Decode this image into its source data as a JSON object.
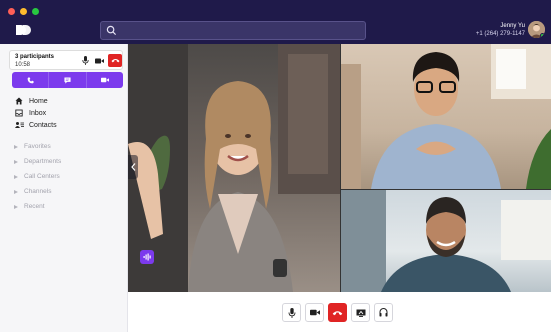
{
  "search": {
    "placeholder": ""
  },
  "user": {
    "name": "Jenny Yu",
    "phone": "+1 (264) 279-1147"
  },
  "call": {
    "participants_label": "3 participants",
    "timer": "10:58"
  },
  "sidebar": {
    "nav": [
      {
        "label": "Home",
        "icon": "home-icon"
      },
      {
        "label": "Inbox",
        "icon": "inbox-icon"
      },
      {
        "label": "Contacts",
        "icon": "contacts-icon"
      }
    ],
    "groups": [
      {
        "label": "Favorites"
      },
      {
        "label": "Departments"
      },
      {
        "label": "Call Centers"
      },
      {
        "label": "Channels"
      },
      {
        "label": "Recent"
      }
    ]
  },
  "colors": {
    "topbar": "#1f1a4a",
    "accent": "#7c3aed",
    "hangup": "#e02424"
  },
  "controls": [
    "mic-icon",
    "video-icon",
    "hangup-icon",
    "screen-share-icon",
    "headset-icon"
  ]
}
